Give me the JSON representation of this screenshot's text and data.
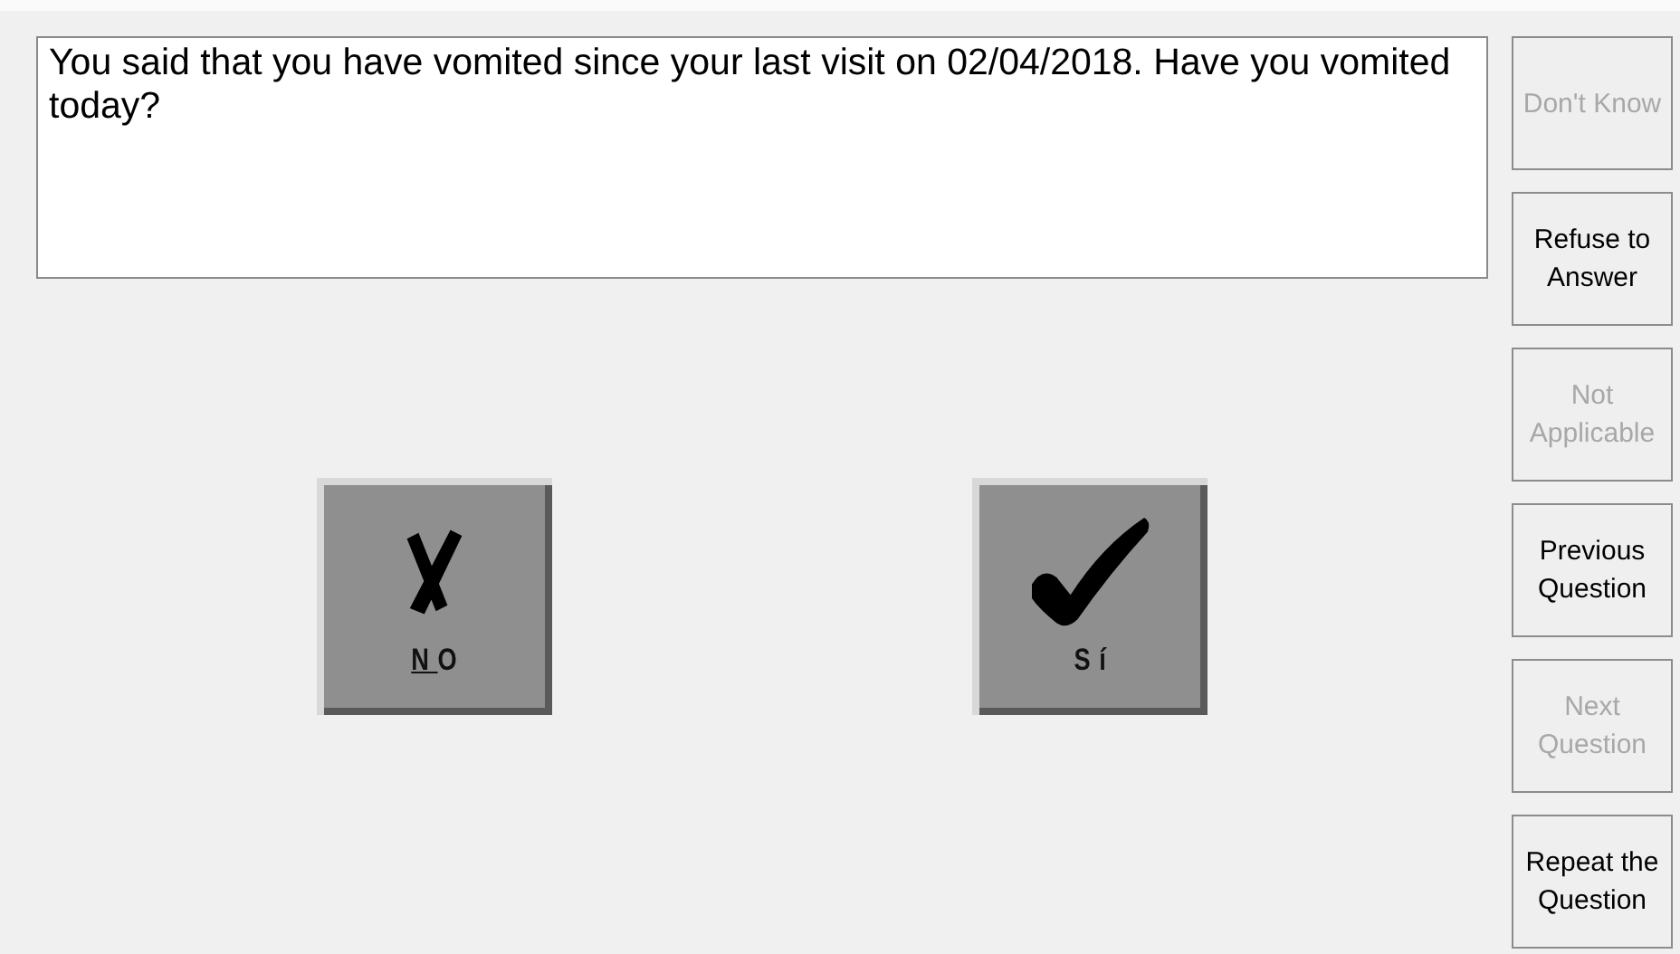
{
  "question": "You said that you have vomited since your last visit on 02/04/2018. Have you vomited today?",
  "answers": [
    {
      "kind": "cross",
      "label": "NO",
      "underline_first": true
    },
    {
      "kind": "check",
      "label": "Sí",
      "underline_first": false
    }
  ],
  "side_buttons": [
    {
      "label": "Don't Know",
      "disabled": true
    },
    {
      "label": "Refuse to Answer",
      "disabled": false
    },
    {
      "label": "Not Applicable",
      "disabled": true
    },
    {
      "label": "Previous Question",
      "disabled": false
    },
    {
      "label": "Next Question",
      "disabled": true
    },
    {
      "label": "Repeat the Question",
      "disabled": false
    }
  ]
}
